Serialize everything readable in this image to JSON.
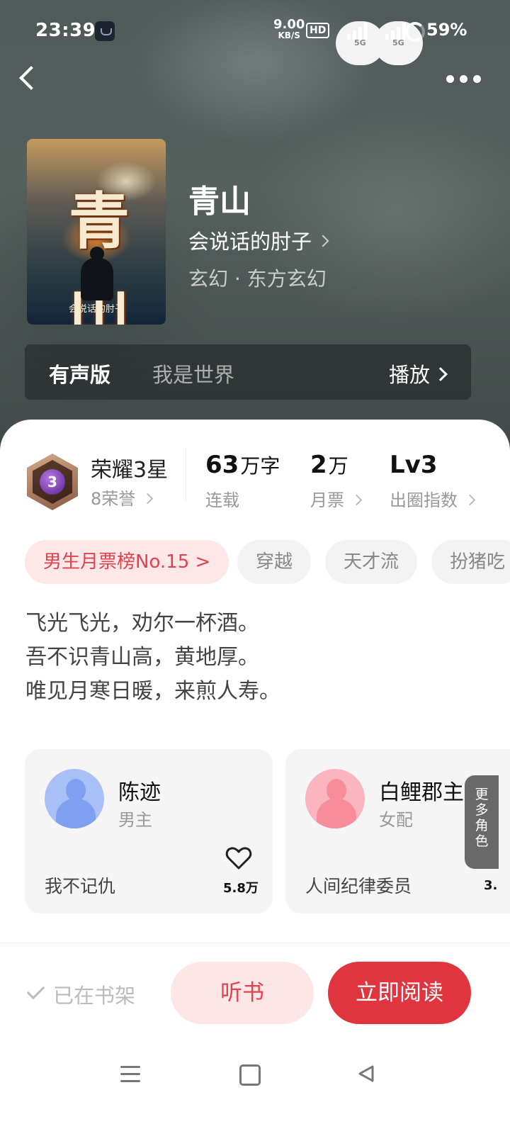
{
  "status_bar": {
    "time": "23:39",
    "net_speed_value": "9.00",
    "net_speed_unit": "KB/S",
    "hd_label": "HD",
    "signal1": "5G",
    "signal2": "5G",
    "battery": "59%"
  },
  "nav": {
    "back_icon": "chevron-left-icon",
    "more_icon": "more-dots-icon"
  },
  "book": {
    "cover_title": "青山",
    "cover_author": "会说话的肘子",
    "title": "青山",
    "author": "会说话的肘子",
    "genre": "玄幻 · 东方玄幻"
  },
  "audio": {
    "label": "有声版",
    "narrator": "我是世界",
    "play": "播放"
  },
  "stats": {
    "honor_level": "3",
    "honor_title": "荣耀3星",
    "honor_sub": "8荣誉",
    "words_value": "63",
    "words_unit": "万字",
    "words_sub": "连载",
    "tickets_value": "2",
    "tickets_unit": "万",
    "tickets_sub": "月票",
    "index_value": "Lv3",
    "index_sub": "出圈指数"
  },
  "tags": [
    "男生月票榜No.15 >",
    "穿越",
    "天才流",
    "扮猪吃"
  ],
  "synopsis": [
    "飞光飞光，劝尔一杯酒。",
    "吾不识青山高，黄地厚。",
    "唯见月寒日暖，来煎人寿。"
  ],
  "characters": [
    {
      "name": "陈迹",
      "role": "男主",
      "quote": "我不记仇",
      "likes": "5.8万",
      "avatar_color": "#7f9ff0"
    },
    {
      "name": "白鲤郡主",
      "role": "女配",
      "quote": "人间纪律委员",
      "likes": "3.",
      "avatar_color": "#f78d9a"
    }
  ],
  "more_roles": [
    "更",
    "多",
    "角",
    "色"
  ],
  "bottom": {
    "shelf": "已在书架",
    "listen": "听书",
    "read": "立即阅读"
  },
  "colors": {
    "accent": "#e0343f",
    "accent_light": "#fde6e6"
  }
}
